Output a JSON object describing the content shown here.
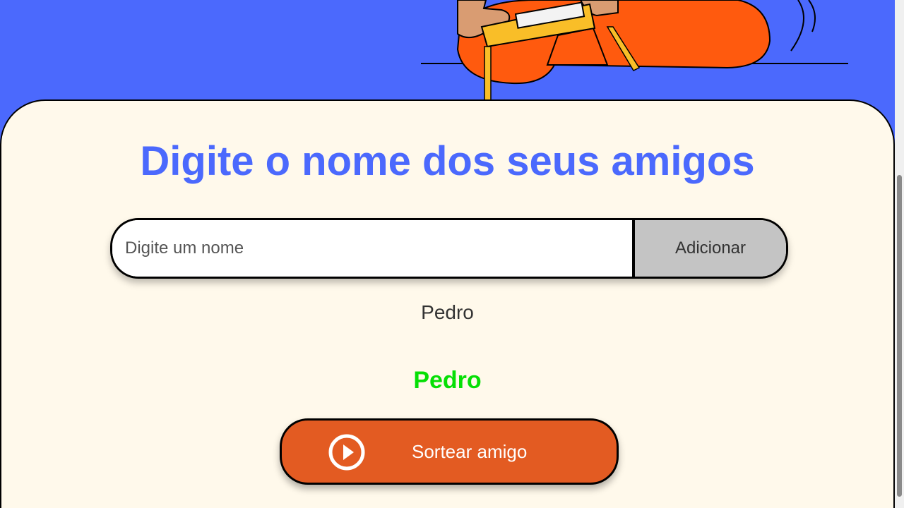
{
  "header": {
    "illustration_icon": "person-playing-game-illustration",
    "colors": {
      "background": "#4B69FD"
    }
  },
  "main": {
    "title": "Digite o nome dos seus amigos",
    "input": {
      "placeholder": "Digite um nome",
      "value": ""
    },
    "add_button_label": "Adicionar",
    "friends": [
      "Pedro"
    ],
    "result": "Pedro",
    "draw_button": {
      "label": "Sortear amigo",
      "icon": "play-circle-icon"
    },
    "colors": {
      "card_background": "#FFF9EB",
      "title": "#4B69FD",
      "result": "#05DF05",
      "draw_button": "#E35B22",
      "add_button": "#C4C4C4"
    }
  }
}
